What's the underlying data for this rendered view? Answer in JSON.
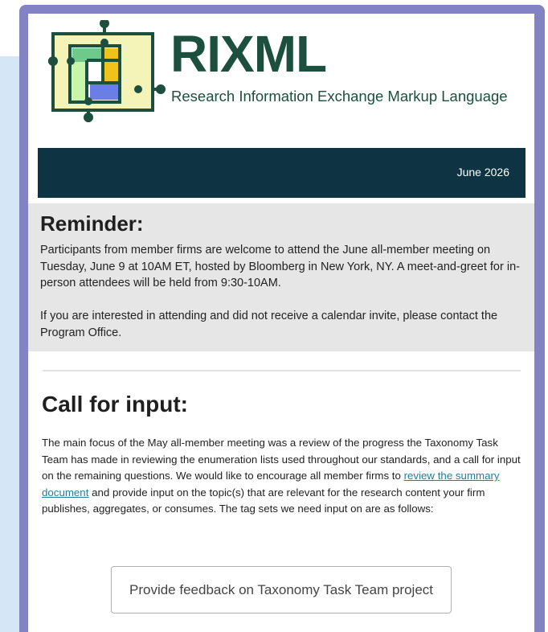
{
  "header": {
    "brand": "RIXML",
    "tagline": "Research Information Exchange Markup Language",
    "logo_icon": "rixml-grid-logo",
    "brand_color": "#1c4f3e"
  },
  "date_bar": {
    "date": "June 2026",
    "color": "#0e3444"
  },
  "reminder": {
    "title": "Reminder:",
    "paragraph1": "Participants from member firms are welcome to attend the June all-member meeting on Tuesday, June 9 at 10AM ET, hosted by Bloomberg in New York, NY. A meet-and-greet for in-person attendees will be held from 9:30-10AM.",
    "paragraph2": "If you are interested in attending and did not receive a calendar invite, please contact the Program Office."
  },
  "call_for_input": {
    "title": "Call for input:",
    "text_before_link": "The main focus of the May all-member meeting was a review of the progress the Taxonomy Task Team has made in reviewing the enumeration lists used throughout our standards, and a call for input on the remaining questions. We would like to encourage all member firms to ",
    "link_text": "review the summary document",
    "text_after_link": " and provide input on the topic(s) that are relevant for the research content your firm publishes, aggregates, or consumes. The tag sets we need input on are as follows:",
    "link_color": "#1f7f9a"
  },
  "feedback_button": {
    "label": "Provide feedback on Taxonomy Task Team project"
  }
}
